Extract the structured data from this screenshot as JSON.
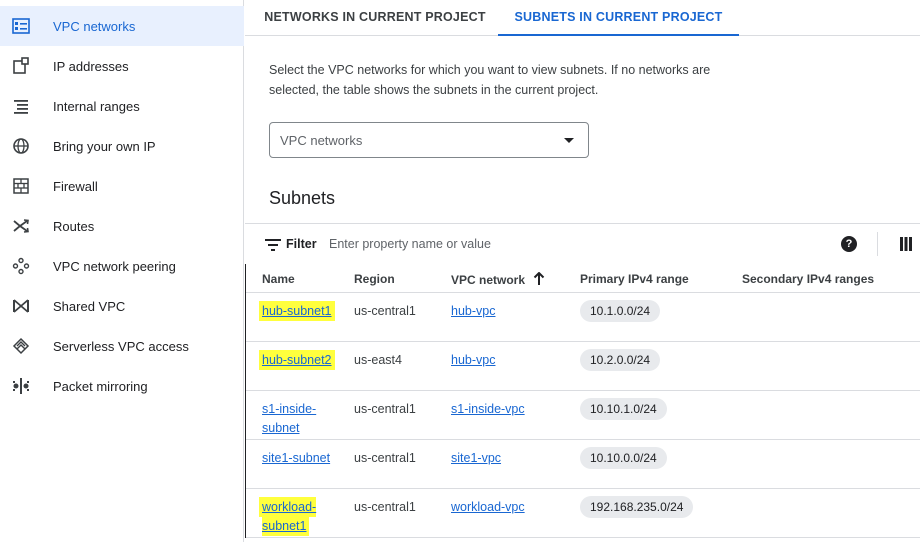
{
  "sidebar": {
    "items": [
      {
        "label": "VPC networks",
        "icon": "vpc-networks-icon",
        "active": true
      },
      {
        "label": "IP addresses",
        "icon": "ip-addresses-icon"
      },
      {
        "label": "Internal ranges",
        "icon": "internal-ranges-icon"
      },
      {
        "label": "Bring your own IP",
        "icon": "globe-icon"
      },
      {
        "label": "Firewall",
        "icon": "firewall-icon"
      },
      {
        "label": "Routes",
        "icon": "routes-icon"
      },
      {
        "label": "VPC network peering",
        "icon": "peering-icon"
      },
      {
        "label": "Shared VPC",
        "icon": "shared-vpc-icon"
      },
      {
        "label": "Serverless VPC access",
        "icon": "serverless-icon"
      },
      {
        "label": "Packet mirroring",
        "icon": "packet-mirroring-icon"
      }
    ]
  },
  "tabs": [
    {
      "label": "NETWORKS IN CURRENT PROJECT",
      "active": false
    },
    {
      "label": "SUBNETS IN CURRENT PROJECT",
      "active": true
    }
  ],
  "description": "Select the VPC networks for which you want to view subnets. If no networks are selected, the table shows the subnets in the current project.",
  "network_select": {
    "placeholder": "VPC networks"
  },
  "section_title": "Subnets",
  "filter": {
    "label": "Filter",
    "placeholder": "Enter property name or value"
  },
  "table": {
    "columns": [
      "Name",
      "Region",
      "VPC network",
      "Primary IPv4 range",
      "Secondary IPv4 ranges"
    ],
    "sorted_column": "VPC network",
    "sort_direction": "ascending",
    "rows": [
      {
        "name": "hub-subnet1",
        "region": "us-central1",
        "network": "hub-vpc",
        "range": "10.1.0.0/24",
        "secondary": "",
        "highlighted": true
      },
      {
        "name": "hub-subnet2",
        "region": "us-east4",
        "network": "hub-vpc",
        "range": "10.2.0.0/24",
        "secondary": "",
        "highlighted": true
      },
      {
        "name": "s1-inside-subnet",
        "region": "us-central1",
        "network": "s1-inside-vpc",
        "range": "10.10.1.0/24",
        "secondary": "",
        "highlighted": false
      },
      {
        "name": "site1-subnet",
        "region": "us-central1",
        "network": "site1-vpc",
        "range": "10.10.0.0/24",
        "secondary": "",
        "highlighted": false
      },
      {
        "name": "workload-subnet1",
        "region": "us-central1",
        "network": "workload-vpc",
        "range": "192.168.235.0/24",
        "secondary": "",
        "highlighted": true
      }
    ]
  },
  "colors": {
    "accent": "#1967d2",
    "highlight": "#ffff3d",
    "chip": "#e8eaed",
    "active_nav_bg": "#e8f0fe"
  }
}
